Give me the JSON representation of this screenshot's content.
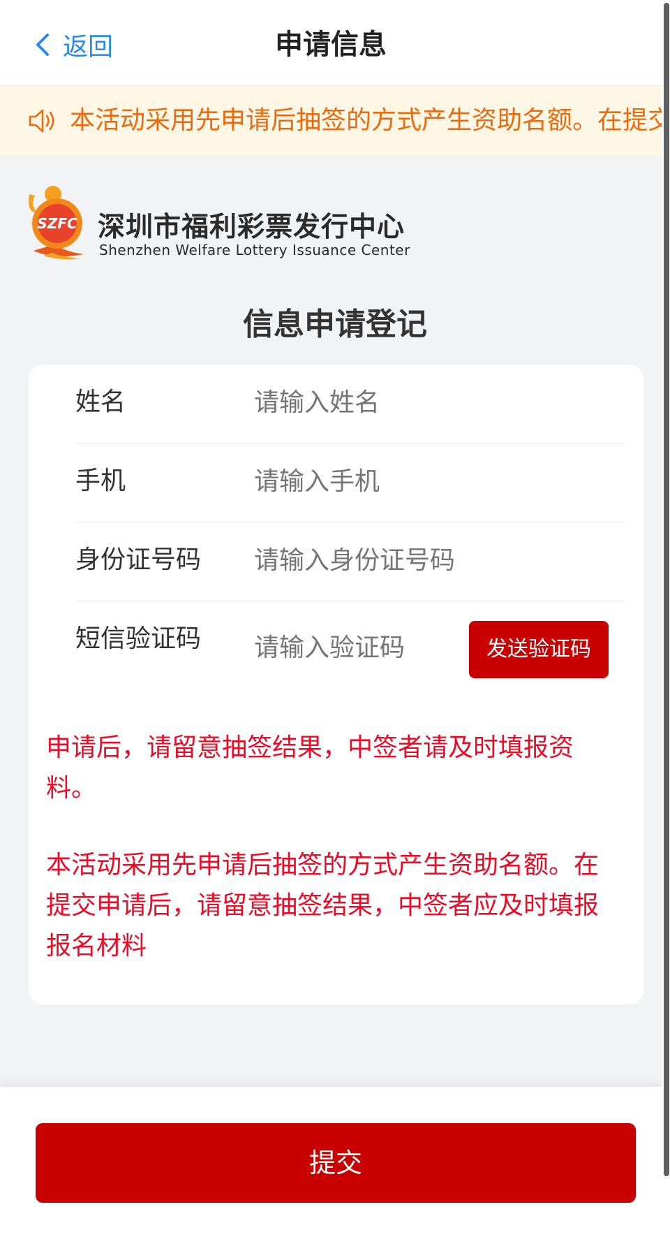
{
  "nav": {
    "back_label": "返回",
    "title": "申请信息"
  },
  "notice": {
    "icon": "speaker-icon",
    "text": "本活动采用先申请后抽签的方式产生资助名额。在提交申请后，请留意抽签结果，中签者应及时填报报名材料"
  },
  "logo": {
    "emblem_text": "SZFC",
    "name_cn": "深圳市福利彩票发行中心",
    "name_en": "Shenzhen Welfare Lottery Issuance Center"
  },
  "form": {
    "title": "信息申请登记",
    "fields": [
      {
        "label": "姓名",
        "placeholder": "请输入姓名"
      },
      {
        "label": "手机",
        "placeholder": "请输入手机"
      },
      {
        "label": "身份证号码",
        "placeholder": "请输入身份证号码"
      },
      {
        "label": "短信验证码",
        "placeholder": "请输入验证码"
      }
    ],
    "send_code_label": "发送验证码",
    "tip1": "申请后，请留意抽签结果，中签者请及时填报资料。",
    "tip2": "本活动采用先申请后抽签的方式产生资助名额。在提交申请后，请留意抽签结果，中签者应及时填报报名材料"
  },
  "submit_label": "提交",
  "colors": {
    "primary_red": "#c80000",
    "link_blue": "#2b8ae8",
    "notice_orange": "#ed6a0c",
    "notice_bg": "#fff7e6",
    "tip_red": "#ee0a24"
  }
}
